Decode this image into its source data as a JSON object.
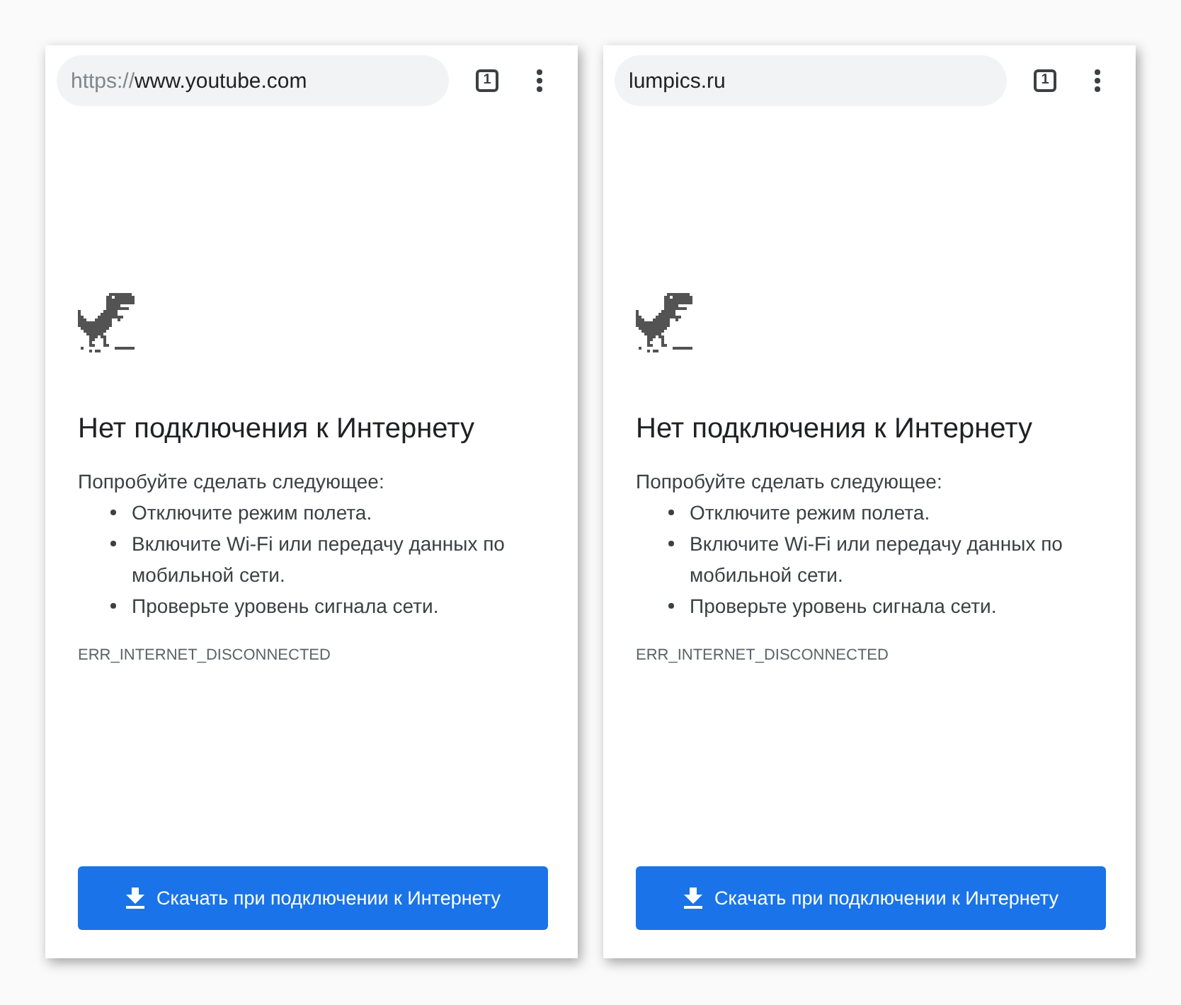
{
  "screens": [
    {
      "address_bar": {
        "scheme": "https://",
        "host": "www.youtube.com"
      },
      "tab_count": "1",
      "error": {
        "title": "Нет подключения к Интернету",
        "intro": "Попробуйте сделать следующее:",
        "suggestions": [
          "Отключите режим полета.",
          "Включите Wi-Fi или передачу данных по мобильной сети.",
          "Проверьте уровень сигнала сети."
        ],
        "code": "ERR_INTERNET_DISCONNECTED"
      },
      "download_button": {
        "label": "Скачать при подключении к Интернету"
      }
    },
    {
      "address_bar": {
        "host": "lumpics.ru"
      },
      "tab_count": "1",
      "error": {
        "title": "Нет подключения к Интернету",
        "intro": "Попробуйте сделать следующее:",
        "suggestions": [
          "Отключите режим полета.",
          "Включите Wi-Fi или передачу данных по мобильной сети.",
          "Проверьте уровень сигнала сети."
        ],
        "code": "ERR_INTERNET_DISCONNECTED"
      },
      "download_button": {
        "label": "Скачать при подключении к Интернету"
      }
    }
  ]
}
